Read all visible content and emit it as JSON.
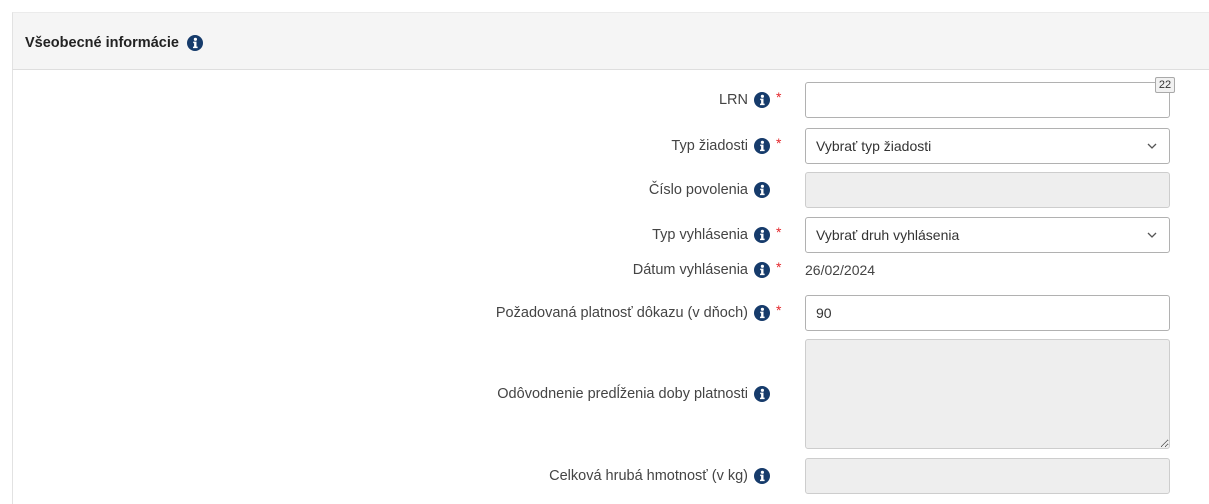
{
  "section": {
    "title": "Všeobecné informácie"
  },
  "required_marker": "*",
  "fields": {
    "lrn": {
      "label": "LRN",
      "required": true,
      "value": "",
      "char_counter": "22"
    },
    "typ_ziadosti": {
      "label": "Typ žiadosti",
      "required": true,
      "selected": "Vybrať typ žiadosti"
    },
    "cislo_povolenia": {
      "label": "Číslo povolenia",
      "required": false,
      "value": "",
      "disabled": true
    },
    "typ_vyhlasenia": {
      "label": "Typ vyhlásenia",
      "required": true,
      "selected": "Vybrať druh vyhlásenia"
    },
    "datum_vyhlasenia": {
      "label": "Dátum vyhlásenia",
      "required": true,
      "value": "26/02/2024"
    },
    "pozadovana_platnost": {
      "label": "Požadovaná platnosť dôkazu (v dňoch)",
      "required": true,
      "value": "90"
    },
    "odovodnenie": {
      "label": "Odôvodnenie predĺženia doby platnosti",
      "required": false,
      "value": "",
      "disabled": true
    },
    "celkova_hmotnost": {
      "label": "Celková hrubá hmotnosť (v kg)",
      "required": false,
      "value": "",
      "disabled": true
    }
  },
  "icons": {
    "info": "info-circle-icon",
    "select_arrow": "chevron-down-icon"
  },
  "colors": {
    "info_icon": "#163b6b",
    "required": "#e3262a",
    "header_bg": "#f5f5f5",
    "disabled_bg": "#eeeeee",
    "input_border": "#b1b1b1"
  }
}
